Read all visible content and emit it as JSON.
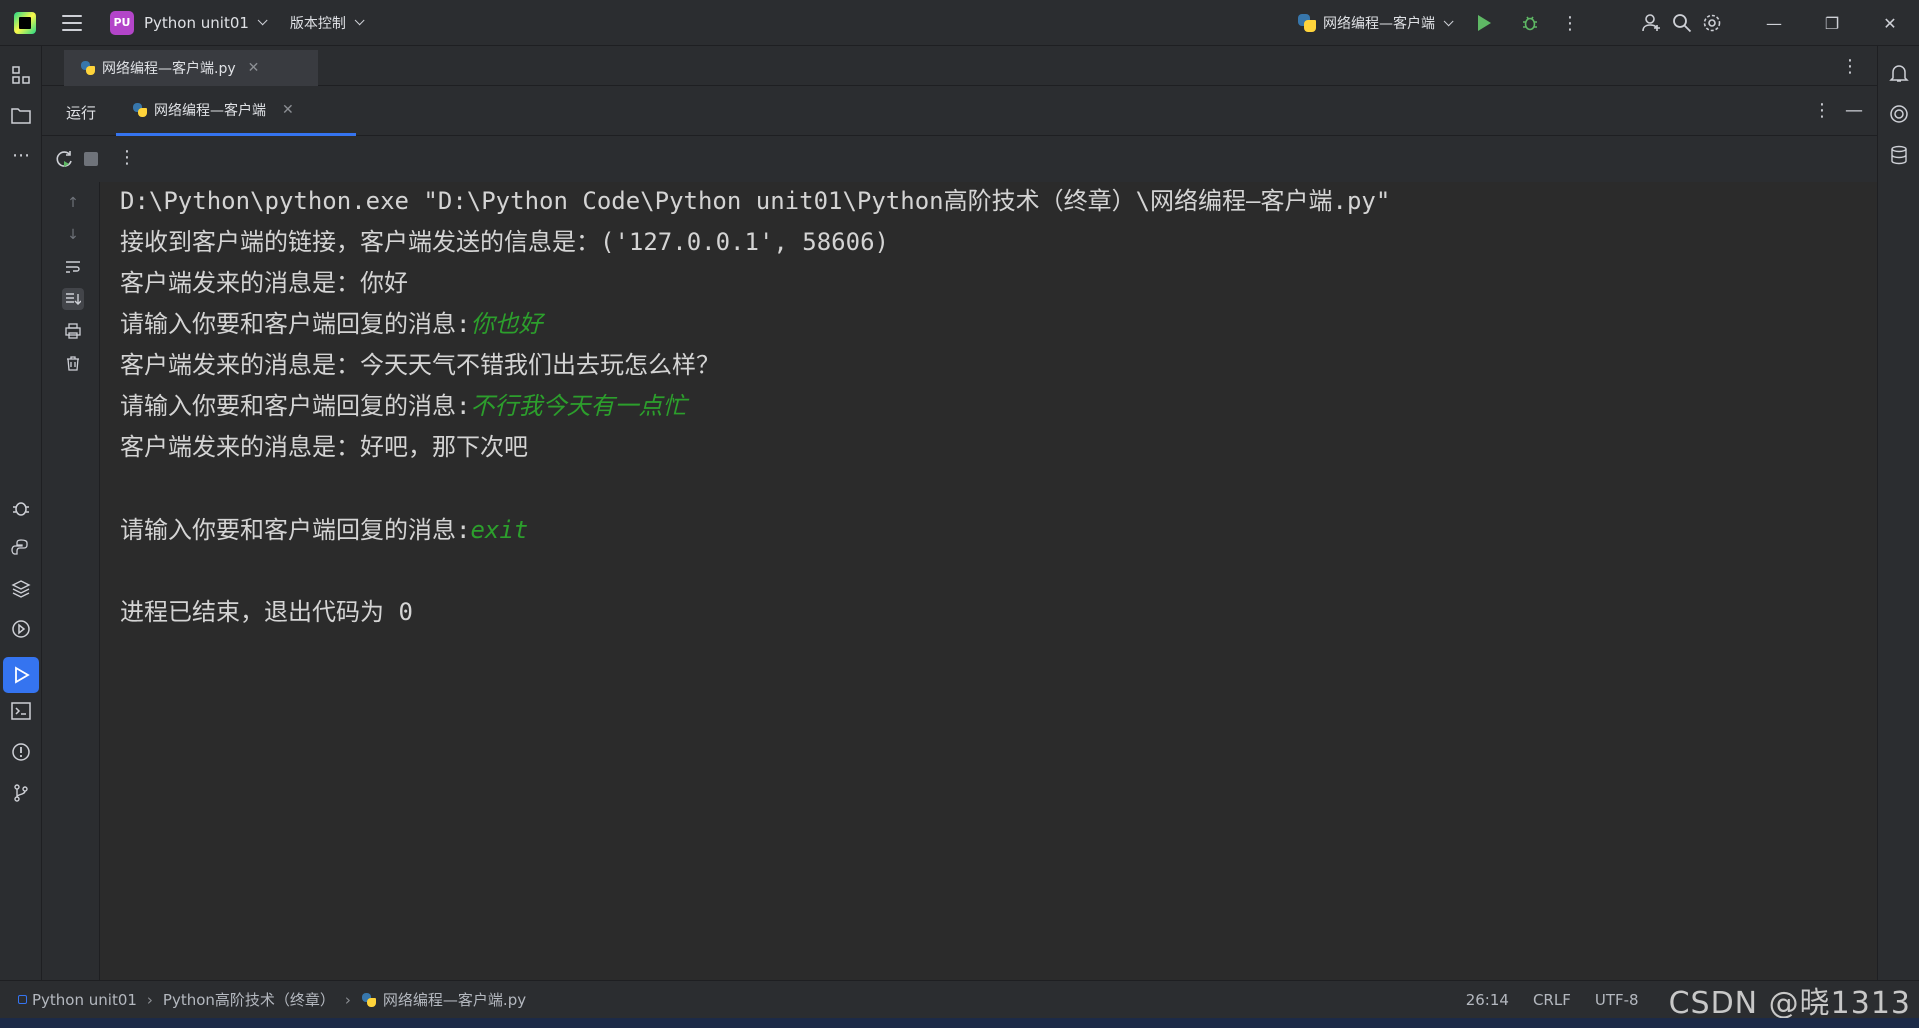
{
  "titlebar": {
    "project_badge": "PU",
    "project_name": "Python unit01",
    "vcs_label": "版本控制",
    "run_config": "网络编程—客户端"
  },
  "editor_tabs": [
    {
      "label": "网络编程—客户端.py"
    }
  ],
  "run_panel": {
    "label": "运行",
    "tab_label": "网络编程—客户端"
  },
  "console": {
    "lines": [
      {
        "text": "D:\\Python\\python.exe \"D:\\Python Code\\Python unit01\\Python高阶技术（终章）\\网络编程—客户端.py\"",
        "input": ""
      },
      {
        "text": "接收到客户端的链接，客户端发送的信息是：('127.0.0.1', 58606)",
        "input": ""
      },
      {
        "text": "客户端发来的消息是：你好",
        "input": ""
      },
      {
        "text": "请输入你要和客户端回复的消息:",
        "input": "你也好"
      },
      {
        "text": "客户端发来的消息是：今天天气不错我们出去玩怎么样？",
        "input": ""
      },
      {
        "text": "请输入你要和客户端回复的消息:",
        "input": "不行我今天有一点忙"
      },
      {
        "text": "客户端发来的消息是：好吧，那下次吧",
        "input": ""
      },
      {
        "text": "请输入你要和客户端回复的消息:",
        "input": "exit"
      },
      {
        "text": "进程已结束，退出代码为 0",
        "input": ""
      }
    ]
  },
  "statusbar": {
    "project": "Python unit01",
    "folder": "Python高阶技术（终章）",
    "file": "网络编程—客户端.py",
    "position": "26:14",
    "line_ending": "CRLF",
    "encoding": "UTF-8",
    "watermark": "CSDN @晓1313"
  },
  "colors": {
    "accent": "#3574f0",
    "user_input": "#2c9f2c",
    "run_green": "#5fb865"
  }
}
